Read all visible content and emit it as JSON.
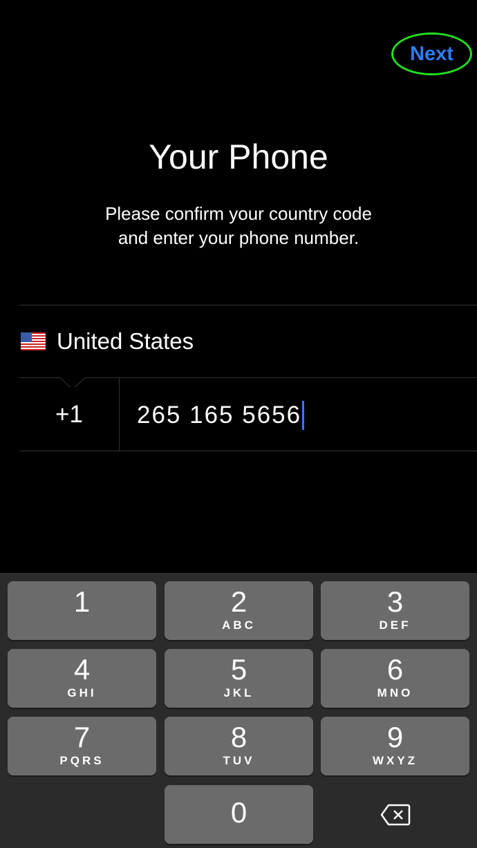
{
  "header": {
    "next_label": "Next",
    "annotation_color": "#22dd22",
    "accent": "#2f7cf6"
  },
  "main": {
    "title": "Your Phone",
    "subtitle_line1": "Please confirm your country code",
    "subtitle_line2": "and enter your phone number.",
    "country": "United States",
    "country_flag": "us-flag-icon",
    "country_code": "+1",
    "phone_number": "265 165 5656"
  },
  "keypad": {
    "keys": [
      {
        "n": "1",
        "l": ""
      },
      {
        "n": "2",
        "l": "ABC"
      },
      {
        "n": "3",
        "l": "DEF"
      },
      {
        "n": "4",
        "l": "GHI"
      },
      {
        "n": "5",
        "l": "JKL"
      },
      {
        "n": "6",
        "l": "MNO"
      },
      {
        "n": "7",
        "l": "PQRS"
      },
      {
        "n": "8",
        "l": "TUV"
      },
      {
        "n": "9",
        "l": "WXYZ"
      },
      {
        "n": "0",
        "l": ""
      }
    ],
    "delete_icon": "backspace-icon"
  }
}
